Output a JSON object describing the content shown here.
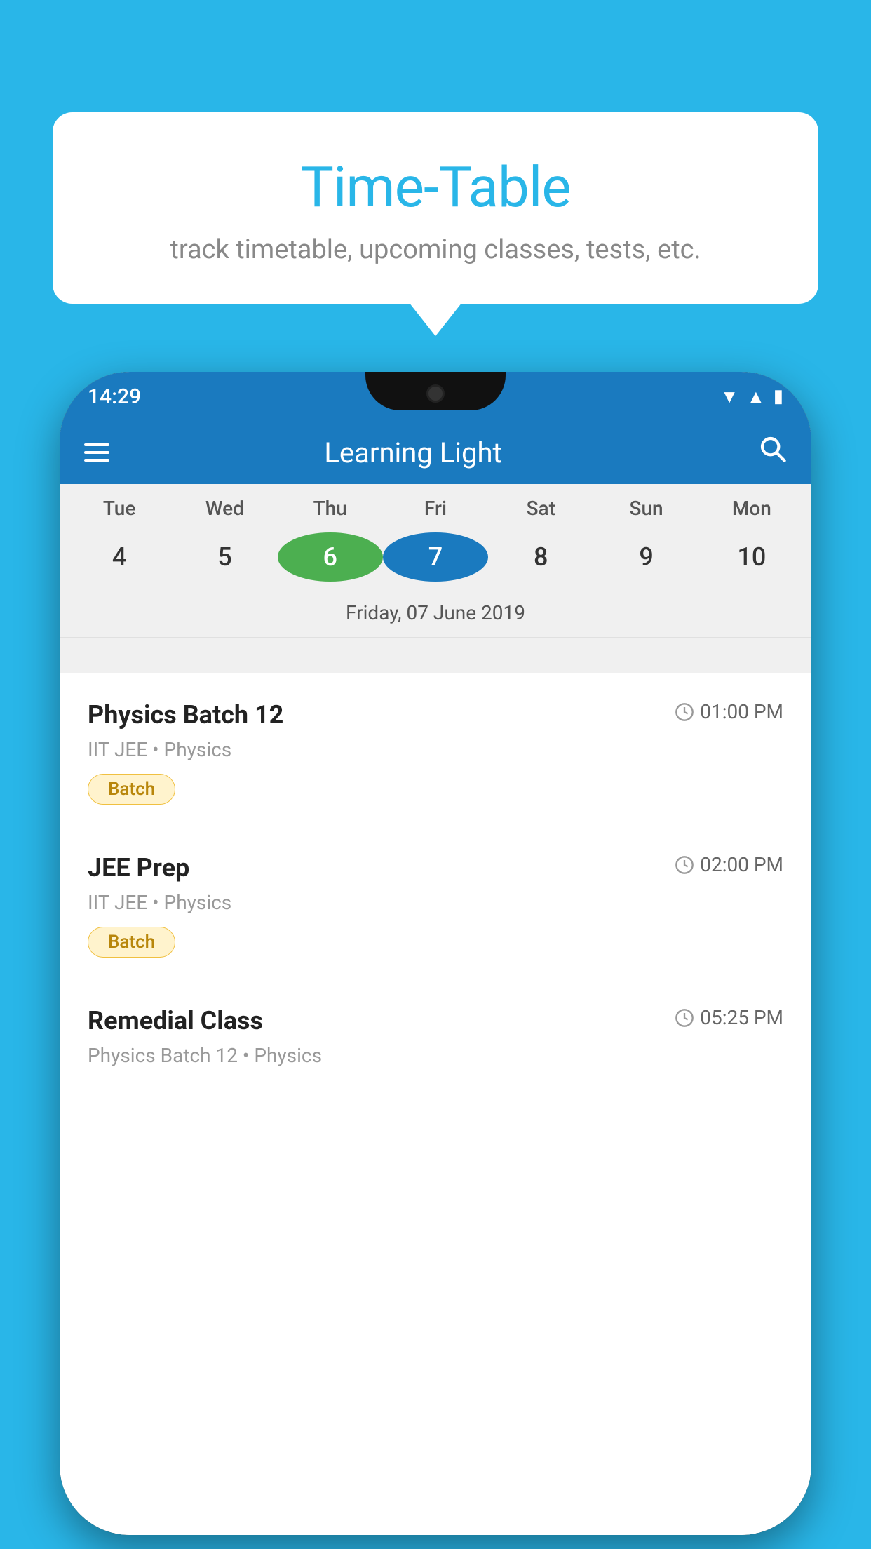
{
  "background_color": "#29b6e8",
  "tooltip": {
    "title": "Time-Table",
    "subtitle": "track timetable, upcoming classes, tests, etc."
  },
  "app": {
    "name": "Learning Light",
    "status_time": "14:29"
  },
  "calendar": {
    "days": [
      "Tue",
      "Wed",
      "Thu",
      "Fri",
      "Sat",
      "Sun",
      "Mon"
    ],
    "dates": [
      "4",
      "5",
      "6",
      "7",
      "8",
      "9",
      "10"
    ],
    "today_index": 2,
    "selected_index": 3,
    "selected_date_label": "Friday, 07 June 2019"
  },
  "schedule": [
    {
      "title": "Physics Batch 12",
      "time": "01:00 PM",
      "subtitle": "IIT JEE • Physics",
      "badge": "Batch"
    },
    {
      "title": "JEE Prep",
      "time": "02:00 PM",
      "subtitle": "IIT JEE • Physics",
      "badge": "Batch"
    },
    {
      "title": "Remedial Class",
      "time": "05:25 PM",
      "subtitle": "Physics Batch 12 • Physics",
      "badge": null
    }
  ],
  "icons": {
    "hamburger": "☰",
    "search": "🔍",
    "clock": "🕐"
  }
}
